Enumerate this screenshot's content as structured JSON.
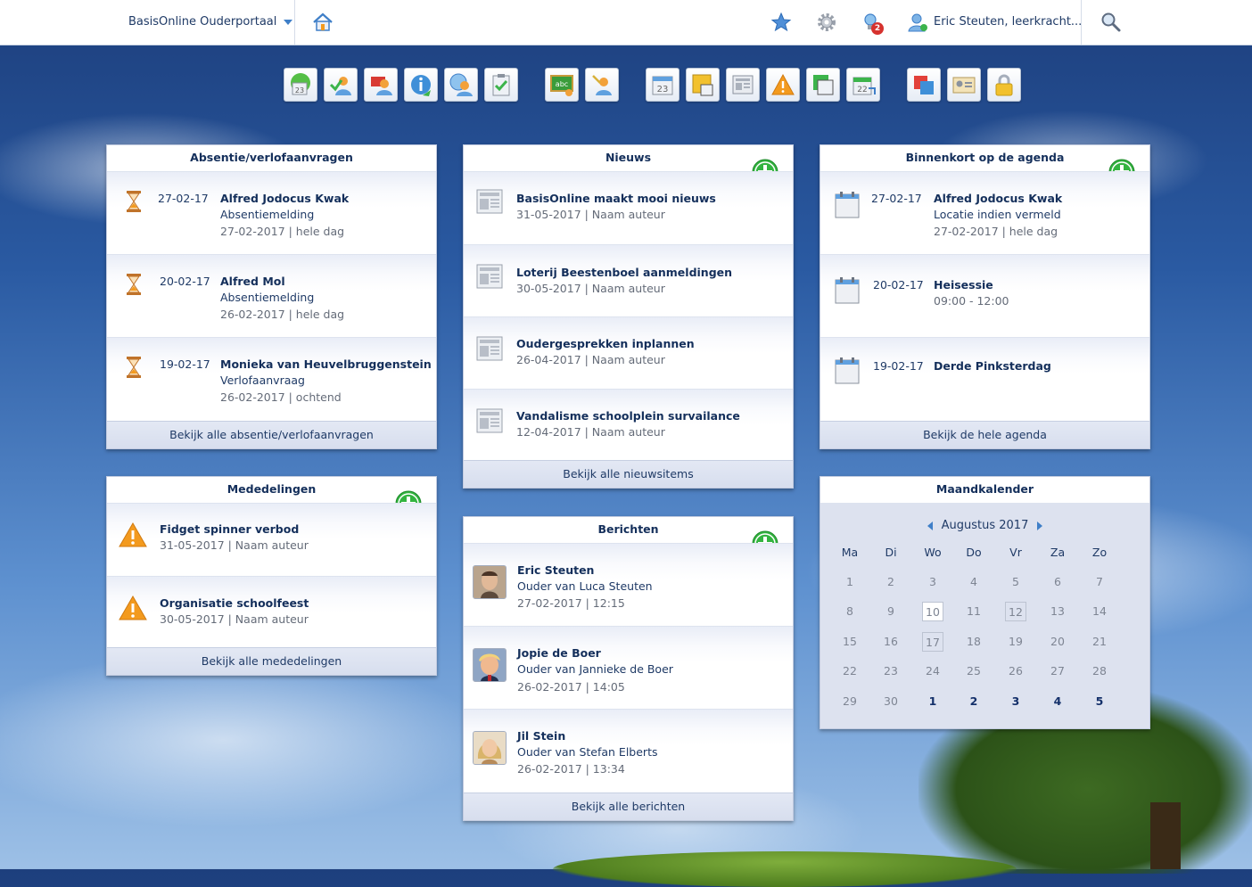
{
  "colors": {
    "accent": "#3f7fc8",
    "text": "#1f3a66",
    "plus_green": "#33b440",
    "warning": "#f39a1e"
  },
  "topbar": {
    "portal_label": "BasisOnline Ouderportaal",
    "notification_count": "2",
    "user_label": "Eric Steuten, leerkracht...",
    "icons": [
      "home-icon",
      "star-icon",
      "gear-icon",
      "notification-icon",
      "user-icon",
      "search-icon"
    ]
  },
  "absentie": {
    "title": "Absentie/verlofaanvragen",
    "items": [
      {
        "date": "27-02-17",
        "name": "Alfred Jodocus Kwak",
        "type": "Absentiemelding",
        "meta": "27-02-2017 | hele dag"
      },
      {
        "date": "20-02-17",
        "name": "Alfred Mol",
        "type": "Absentiemelding",
        "meta": "26-02-2017 | hele dag"
      },
      {
        "date": "19-02-17",
        "name": "Monieka van Heuvelbruggenstein",
        "type": "Verlofaanvraag",
        "meta": "26-02-2017 | ochtend"
      }
    ],
    "footer": "Bekijk alle absentie/verlofaanvragen"
  },
  "mededelingen": {
    "title": "Mededelingen",
    "items": [
      {
        "title": "Fidget spinner verbod",
        "meta": "31-05-2017 | Naam auteur"
      },
      {
        "title": "Organisatie schoolfeest",
        "meta": "30-05-2017 | Naam auteur"
      }
    ],
    "footer": "Bekijk alle mededelingen"
  },
  "nieuws": {
    "title": "Nieuws",
    "items": [
      {
        "title": "BasisOnline maakt mooi nieuws",
        "meta": "31-05-2017 | Naam auteur"
      },
      {
        "title": "Loterij Beestenboel aanmeldingen",
        "meta": "30-05-2017 | Naam auteur"
      },
      {
        "title": "Oudergesprekken inplannen",
        "meta": "26-04-2017 | Naam auteur"
      },
      {
        "title": "Vandalisme schoolplein survailance",
        "meta": "12-04-2017 | Naam auteur"
      }
    ],
    "footer": "Bekijk alle nieuwsitems"
  },
  "berichten": {
    "title": "Berichten",
    "items": [
      {
        "name": "Eric Steuten",
        "sub": "Ouder van Luca Steuten",
        "meta": "27-02-2017 | 12:15"
      },
      {
        "name": "Jopie de Boer",
        "sub": "Ouder van Jannieke de Boer",
        "meta": "26-02-2017 | 14:05"
      },
      {
        "name": "Jil Stein",
        "sub": "Ouder van Stefan Elberts",
        "meta": "26-02-2017 | 13:34"
      }
    ],
    "footer": "Bekijk alle berichten"
  },
  "agenda": {
    "title": "Binnenkort op de agenda",
    "items": [
      {
        "date": "27-02-17",
        "title": "Alfred Jodocus Kwak",
        "sub": "Locatie indien vermeld",
        "meta": "27-02-2017 | hele dag"
      },
      {
        "date": "20-02-17",
        "title": "Heisessie",
        "sub": "09:00 - 12:00",
        "meta": ""
      },
      {
        "date": "19-02-17",
        "title": "Derde Pinksterdag",
        "sub": "",
        "meta": ""
      }
    ],
    "footer": "Bekijk de hele agenda"
  },
  "kalender": {
    "title": "Maandkalender",
    "month": "Augustus 2017",
    "weekdays": [
      "Ma",
      "Di",
      "Wo",
      "Do",
      "Vr",
      "Za",
      "Zo"
    ],
    "weeks": [
      [
        "1",
        "2",
        "3",
        "4",
        "5",
        "6",
        "7"
      ],
      [
        "8",
        "9",
        "10",
        "11",
        "12",
        "13",
        "14"
      ],
      [
        "15",
        "16",
        "17",
        "18",
        "19",
        "20",
        "21"
      ],
      [
        "22",
        "23",
        "24",
        "25",
        "26",
        "27",
        "28"
      ],
      [
        "29",
        "30",
        "1",
        "2",
        "3",
        "4",
        "5"
      ]
    ],
    "highlighted": [
      "10",
      "12",
      "17"
    ]
  }
}
